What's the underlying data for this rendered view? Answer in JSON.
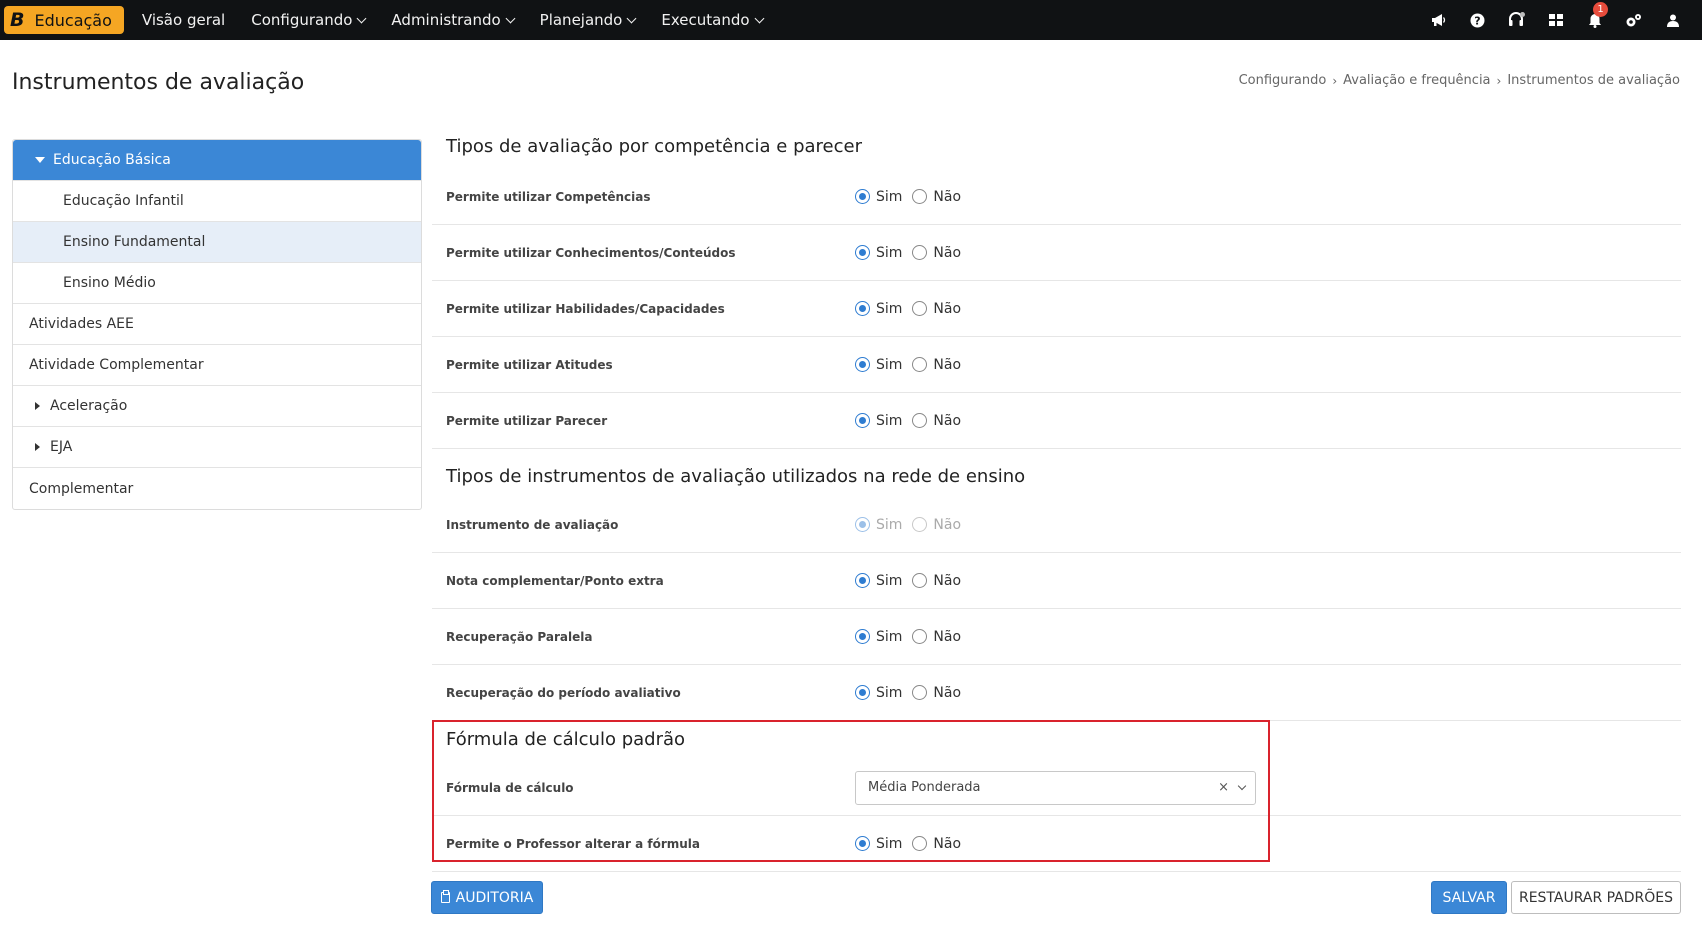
{
  "topbar": {
    "brand_letter": "B",
    "brand_name": "Educação",
    "nav": [
      {
        "label": "Visão geral",
        "dropdown": false
      },
      {
        "label": "Configurando",
        "dropdown": true
      },
      {
        "label": "Administrando",
        "dropdown": true
      },
      {
        "label": "Planejando",
        "dropdown": true
      },
      {
        "label": "Executando",
        "dropdown": true
      }
    ],
    "icons": [
      "megaphone-icon",
      "help-icon",
      "headset-icon",
      "apps-grid-icon",
      "bell-icon",
      "settings-icon",
      "user-icon"
    ],
    "notification_count": "1"
  },
  "page": {
    "title": "Instrumentos de avaliação",
    "breadcrumb": [
      "Configurando",
      "Avaliação e frequência",
      "Instrumentos de avaliação"
    ]
  },
  "sidebar": {
    "items": [
      {
        "label": "Educação Básica",
        "level": 0,
        "state": "active",
        "caret": "down"
      },
      {
        "label": "Educação Infantil",
        "level": 1,
        "state": "",
        "caret": ""
      },
      {
        "label": "Ensino Fundamental",
        "level": 1,
        "state": "selected",
        "caret": ""
      },
      {
        "label": "Ensino Médio",
        "level": 1,
        "state": "",
        "caret": ""
      },
      {
        "label": "Atividades AEE",
        "level": 0,
        "state": "",
        "caret": ""
      },
      {
        "label": "Atividade Complementar",
        "level": 0,
        "state": "",
        "caret": ""
      },
      {
        "label": "Aceleração",
        "level": 0,
        "state": "",
        "caret": "right"
      },
      {
        "label": "EJA",
        "level": 0,
        "state": "",
        "caret": "right"
      },
      {
        "label": "Complementar",
        "level": 0,
        "state": "",
        "caret": ""
      }
    ]
  },
  "options": {
    "yes": "Sim",
    "no": "Não"
  },
  "sections": {
    "competencias": {
      "title": "Tipos de avaliação por competência e parecer",
      "rows": [
        {
          "label": "Permite utilizar Competências",
          "value": "Sim"
        },
        {
          "label": "Permite utilizar Conhecimentos/Conteúdos",
          "value": "Sim"
        },
        {
          "label": "Permite utilizar Habilidades/Capacidades",
          "value": "Sim"
        },
        {
          "label": "Permite utilizar Atitudes",
          "value": "Sim"
        },
        {
          "label": "Permite utilizar Parecer",
          "value": "Sim"
        }
      ]
    },
    "instrumentos": {
      "title": "Tipos de instrumentos de avaliação utilizados na rede de ensino",
      "rows": [
        {
          "label": "Instrumento de avaliação",
          "value": "Sim",
          "disabled": true
        },
        {
          "label": "Nota complementar/Ponto extra",
          "value": "Sim"
        },
        {
          "label": "Recuperação Paralela",
          "value": "Sim"
        },
        {
          "label": "Recuperação do período avaliativo",
          "value": "Sim"
        }
      ]
    },
    "formula": {
      "title": "Fórmula de cálculo padrão",
      "select_label": "Fórmula de cálculo",
      "select_value": "Média Ponderada",
      "clear_symbol": "×",
      "teacher_label": "Permite o Professor alterar a fórmula",
      "teacher_value": "Sim",
      "highlight_color": "#d9232d"
    }
  },
  "buttons": {
    "audit": "AUDITORIA",
    "save": "SALVAR",
    "restore": "RESTAURAR PADRÕES"
  },
  "colors": {
    "primary": "#3b87d6",
    "brand": "#f5a623",
    "topbar": "#101214"
  }
}
